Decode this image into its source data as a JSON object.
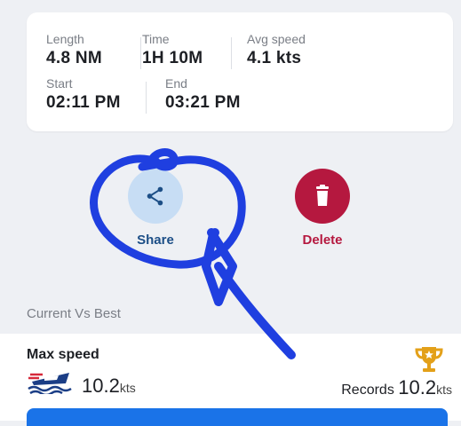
{
  "trip": {
    "length_label": "Length",
    "length_value": "4.8 NM",
    "time_label": "Time",
    "time_value": "1H 10M",
    "avg_label": "Avg speed",
    "avg_value": "4.1 kts",
    "start_label": "Start",
    "start_value": "02:11 PM",
    "end_label": "End",
    "end_value": "03:21 PM"
  },
  "actions": {
    "share_label": "Share",
    "delete_label": "Delete"
  },
  "comparison": {
    "section_title": "Current Vs Best",
    "metric_title": "Max speed",
    "current_value": "10.2",
    "current_unit": "kts",
    "records_label": "Records",
    "records_value": "10.2",
    "records_unit": "kts"
  },
  "colors": {
    "share_accent": "#c7ddf4",
    "delete_accent": "#b5183f",
    "annotation_ink": "#1f3fe0",
    "trophy": "#e3a019",
    "primary_bar": "#1a73e8"
  },
  "icons": {
    "share": "share-icon",
    "delete": "trash-icon",
    "trophy": "trophy-icon",
    "boat": "boat-icon"
  }
}
